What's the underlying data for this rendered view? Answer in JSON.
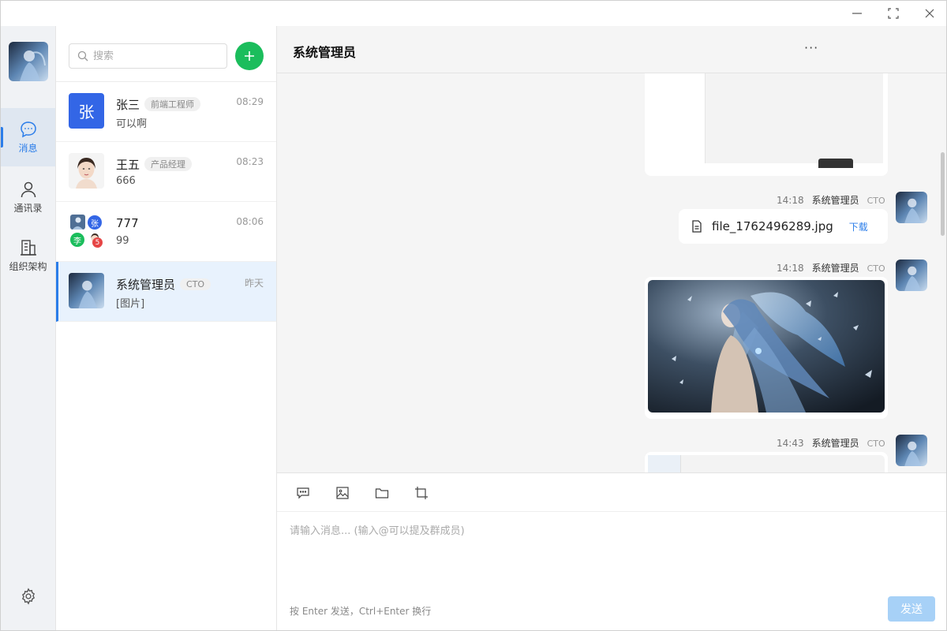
{
  "window": {
    "minimize_icon": "minimize-icon",
    "maximize_icon": "maximize-icon",
    "close_icon": "close-icon"
  },
  "rail": {
    "items": [
      {
        "label": "消息",
        "icon": "chat-bubble-icon",
        "active": true
      },
      {
        "label": "通讯录",
        "icon": "contact-icon",
        "active": false
      },
      {
        "label": "组织架构",
        "icon": "building-icon",
        "active": false
      }
    ],
    "settings_icon": "gear-icon"
  },
  "search": {
    "placeholder": "搜索"
  },
  "conversations": [
    {
      "name": "张三",
      "tag": "前端工程师",
      "last": "可以啊",
      "time": "08:29",
      "avatar_char": "张",
      "avatar_color": "#3366e6"
    },
    {
      "name": "王五",
      "tag": "产品经理",
      "last": "666",
      "time": "08:23"
    },
    {
      "name": "777",
      "tag": "",
      "last": "99",
      "time": "08:06",
      "group_chars": [
        "张",
        "李"
      ],
      "group_extra": "5"
    },
    {
      "name": "系统管理员",
      "tag": "CTO",
      "last": "[图片]",
      "time": "昨天",
      "active": true
    }
  ],
  "chat": {
    "title": "系统管理员",
    "more_label": "···",
    "messages": [
      {
        "time": "14:18",
        "sender": "系统管理员",
        "role": "CTO",
        "type": "file",
        "file_name": "file_1762496289.jpg",
        "download_label": "下载"
      },
      {
        "time": "14:18",
        "sender": "系统管理员",
        "role": "CTO",
        "type": "image"
      },
      {
        "time": "14:43",
        "sender": "系统管理员",
        "role": "CTO",
        "type": "image"
      }
    ]
  },
  "composer": {
    "placeholder": "请输入消息... (输入@可以提及群成员)",
    "hint": "按 Enter 发送，Ctrl+Enter 换行",
    "send_label": "发送"
  },
  "colors": {
    "accent": "#2b7de9",
    "add_button": "#1bbd5c",
    "send_disabled": "#a7d1f7",
    "active_conv_bg": "#e8f2fd"
  }
}
